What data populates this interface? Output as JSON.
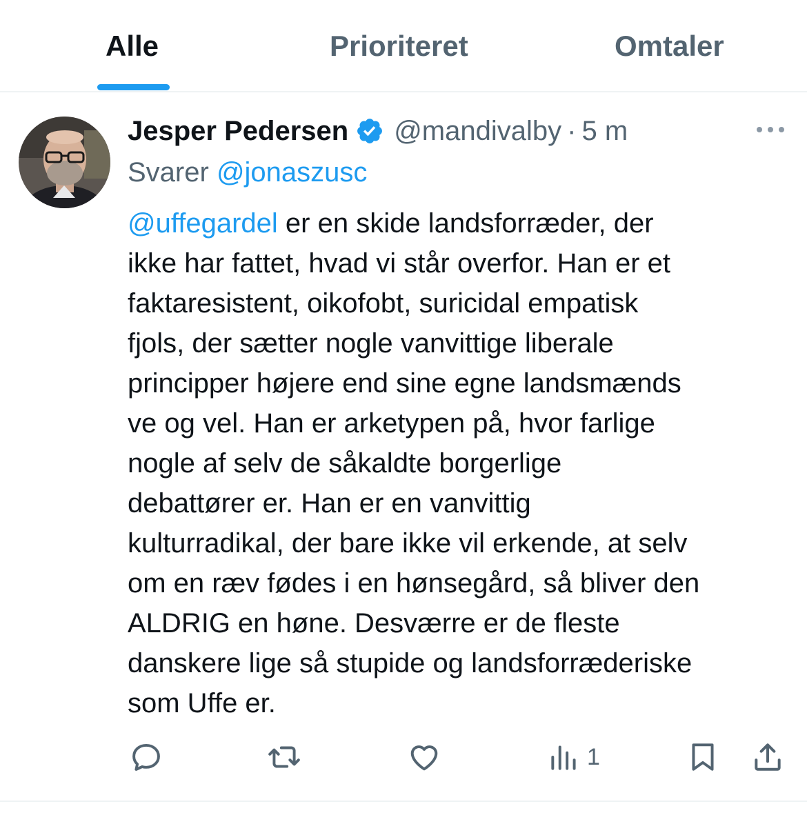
{
  "tabs": [
    {
      "label": "Alle",
      "active": true
    },
    {
      "label": "Prioriteret",
      "active": false
    },
    {
      "label": "Omtaler",
      "active": false
    }
  ],
  "tweet": {
    "display_name": "Jesper Pedersen",
    "verified": true,
    "handle": "@mandivalby",
    "separator": "·",
    "time": "5 m",
    "reply_prefix": "Svarer",
    "reply_to": "@jonaszusc",
    "mention": "@uffegardel",
    "lines": [
      " er en skide landsforræder, der",
      "ikke har fattet, hvad vi står overfor. Han er et",
      "faktaresistent, oikofobt, suricidal empatisk",
      "fjols, der sætter nogle vanvittige liberale",
      "principper højere end sine egne landsmænds",
      "ve og vel. Han er arketypen på, hvor farlige",
      "nogle af selv de såkaldte borgerlige",
      "debattører er. Han er en vanvittig",
      "kulturradikal, der bare ikke vil erkende, at selv",
      "om en ræv fødes i en hønsegård, så bliver den",
      "ALDRIG en høne. Desværre er de fleste",
      "danskere lige så stupide og landsforræderiske",
      "som Uffe er."
    ],
    "actions": {
      "reply_icon": "reply-icon",
      "retweet_icon": "retweet-icon",
      "like_icon": "heart-icon",
      "views_icon": "views-icon",
      "views_count": "1",
      "bookmark_icon": "bookmark-icon",
      "share_icon": "share-icon"
    }
  },
  "colors": {
    "accent": "#1d9bf0",
    "text": "#0f1419",
    "secondary": "#536471",
    "border": "#eff3f4"
  }
}
